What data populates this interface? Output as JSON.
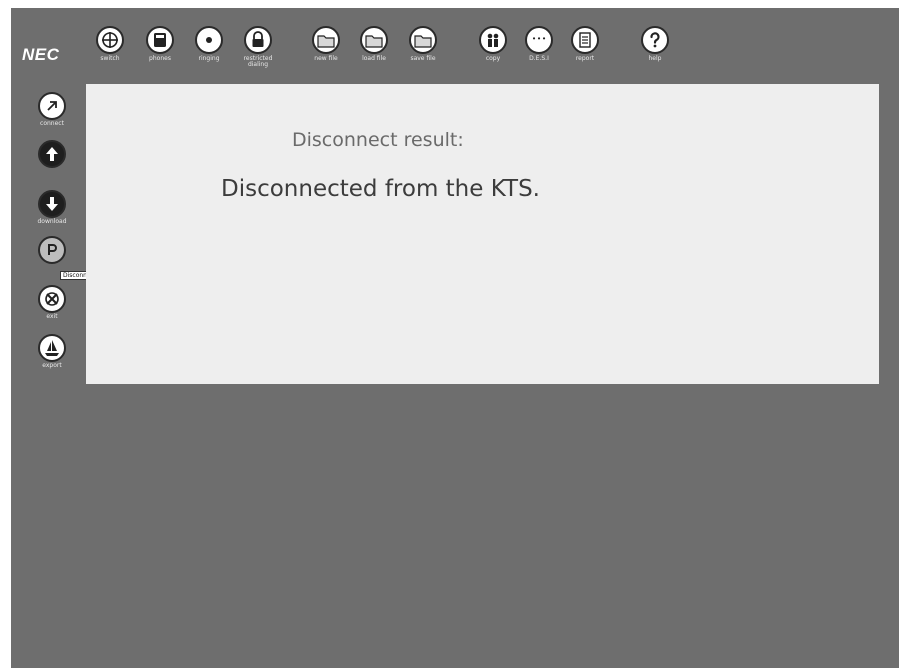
{
  "brand": {
    "logo": "NEC"
  },
  "toolbar": {
    "items": [
      {
        "icon": "switch-icon",
        "label": "switch"
      },
      {
        "icon": "phones-icon",
        "label": "phones"
      },
      {
        "icon": "ringing-icon",
        "label": "ringing"
      },
      {
        "icon": "lock-icon",
        "label": "restricted dialing"
      },
      {
        "icon": "folder-icon",
        "label": "new file"
      },
      {
        "icon": "folder-icon",
        "label": "load file"
      },
      {
        "icon": "folder-icon",
        "label": "save file"
      },
      {
        "icon": "copy-people-icon",
        "label": "copy"
      },
      {
        "icon": "dss-icon",
        "label": "D.E.S.I",
        "glyph": "• • •"
      },
      {
        "icon": "report-icon",
        "label": "report"
      },
      {
        "icon": "help-icon",
        "label": "help"
      }
    ]
  },
  "sidebar": {
    "items": [
      {
        "icon": "connect-icon",
        "label": "connect"
      },
      {
        "icon": "upload-icon",
        "label": ""
      },
      {
        "icon": "download-icon",
        "label": "download"
      },
      {
        "icon": "disconnect-icon",
        "label": ""
      },
      {
        "icon": "exit-icon",
        "label": "exit"
      },
      {
        "icon": "sailboat-icon",
        "label": "export"
      }
    ],
    "tooltip": "Disconnect from KTS"
  },
  "main": {
    "result_label": "Disconnect result:",
    "result_message": "Disconnected from the KTS."
  }
}
